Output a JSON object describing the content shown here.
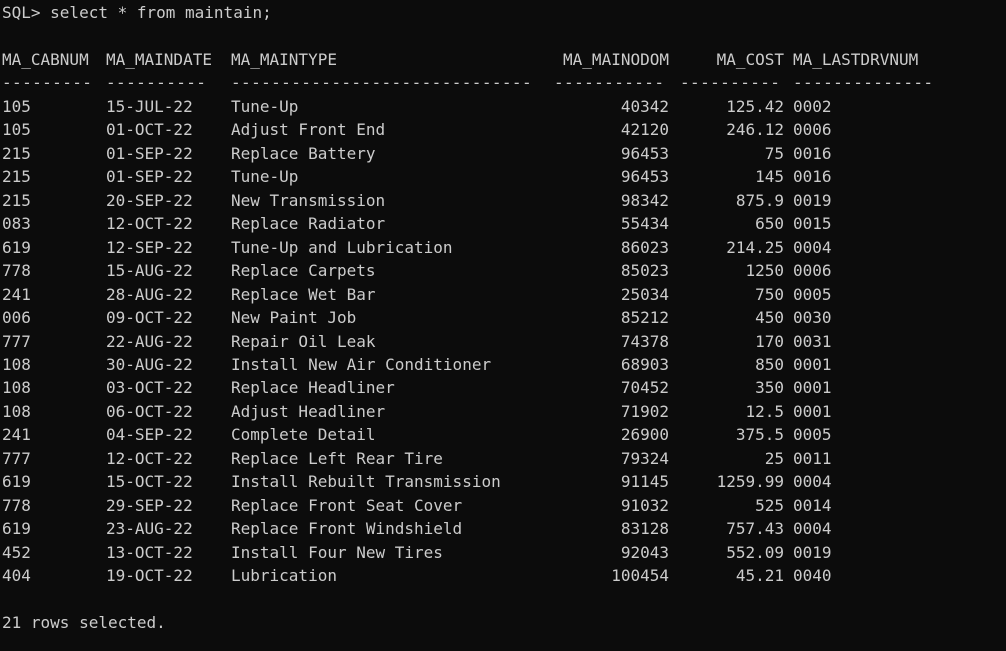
{
  "prompt": "SQL> select * from maintain;",
  "columns": {
    "cabnum": "MA_CABNUM",
    "maindate": "MA_MAINDATE",
    "maintype": "MA_MAINTYPE",
    "mainodom": "MA_MAINODOM",
    "cost": "MA_COST",
    "lastdrvnum": "MA_LASTDRVNUM"
  },
  "separators": {
    "cabnum": "---------",
    "maindate": "----------",
    "maintype": "------------------------------",
    "mainodom": "-----------",
    "cost": "----------",
    "lastdrvnum": "--------------"
  },
  "rows": [
    [
      "105",
      "15-JUL-22",
      "Tune-Up",
      "40342",
      "125.42",
      "0002"
    ],
    [
      "105",
      "01-OCT-22",
      "Adjust Front End",
      "42120",
      "246.12",
      "0006"
    ],
    [
      "215",
      "01-SEP-22",
      "Replace Battery",
      "96453",
      "75",
      "0016"
    ],
    [
      "215",
      "01-SEP-22",
      "Tune-Up",
      "96453",
      "145",
      "0016"
    ],
    [
      "215",
      "20-SEP-22",
      "New Transmission",
      "98342",
      "875.9",
      "0019"
    ],
    [
      "083",
      "12-OCT-22",
      "Replace Radiator",
      "55434",
      "650",
      "0015"
    ],
    [
      "619",
      "12-SEP-22",
      "Tune-Up and Lubrication",
      "86023",
      "214.25",
      "0004"
    ],
    [
      "778",
      "15-AUG-22",
      "Replace Carpets",
      "85023",
      "1250",
      "0006"
    ],
    [
      "241",
      "28-AUG-22",
      "Replace Wet Bar",
      "25034",
      "750",
      "0005"
    ],
    [
      "006",
      "09-OCT-22",
      "New Paint Job",
      "85212",
      "450",
      "0030"
    ],
    [
      "777",
      "22-AUG-22",
      "Repair Oil Leak",
      "74378",
      "170",
      "0031"
    ],
    [
      "108",
      "30-AUG-22",
      "Install New Air Conditioner",
      "68903",
      "850",
      "0001"
    ],
    [
      "108",
      "03-OCT-22",
      "Replace Headliner",
      "70452",
      "350",
      "0001"
    ],
    [
      "108",
      "06-OCT-22",
      "Adjust Headliner",
      "71902",
      "12.5",
      "0001"
    ],
    [
      "241",
      "04-SEP-22",
      "Complete Detail",
      "26900",
      "375.5",
      "0005"
    ],
    [
      "777",
      "12-OCT-22",
      "Replace Left Rear Tire",
      "79324",
      "25",
      "0011"
    ],
    [
      "619",
      "15-OCT-22",
      "Install Rebuilt Transmission",
      "91145",
      "1259.99",
      "0004"
    ],
    [
      "778",
      "29-SEP-22",
      "Replace Front Seat Cover",
      "91032",
      "525",
      "0014"
    ],
    [
      "619",
      "23-AUG-22",
      "Replace Front Windshield",
      "83128",
      "757.43",
      "0004"
    ],
    [
      "452",
      "13-OCT-22",
      "Install Four New Tires",
      "92043",
      "552.09",
      "0019"
    ],
    [
      "404",
      "19-OCT-22",
      "Lubrication",
      "100454",
      "45.21",
      "0040"
    ]
  ],
  "footer": "21 rows selected.",
  "colors": {
    "background": "#0c0c0c",
    "text": "#cccccc"
  }
}
